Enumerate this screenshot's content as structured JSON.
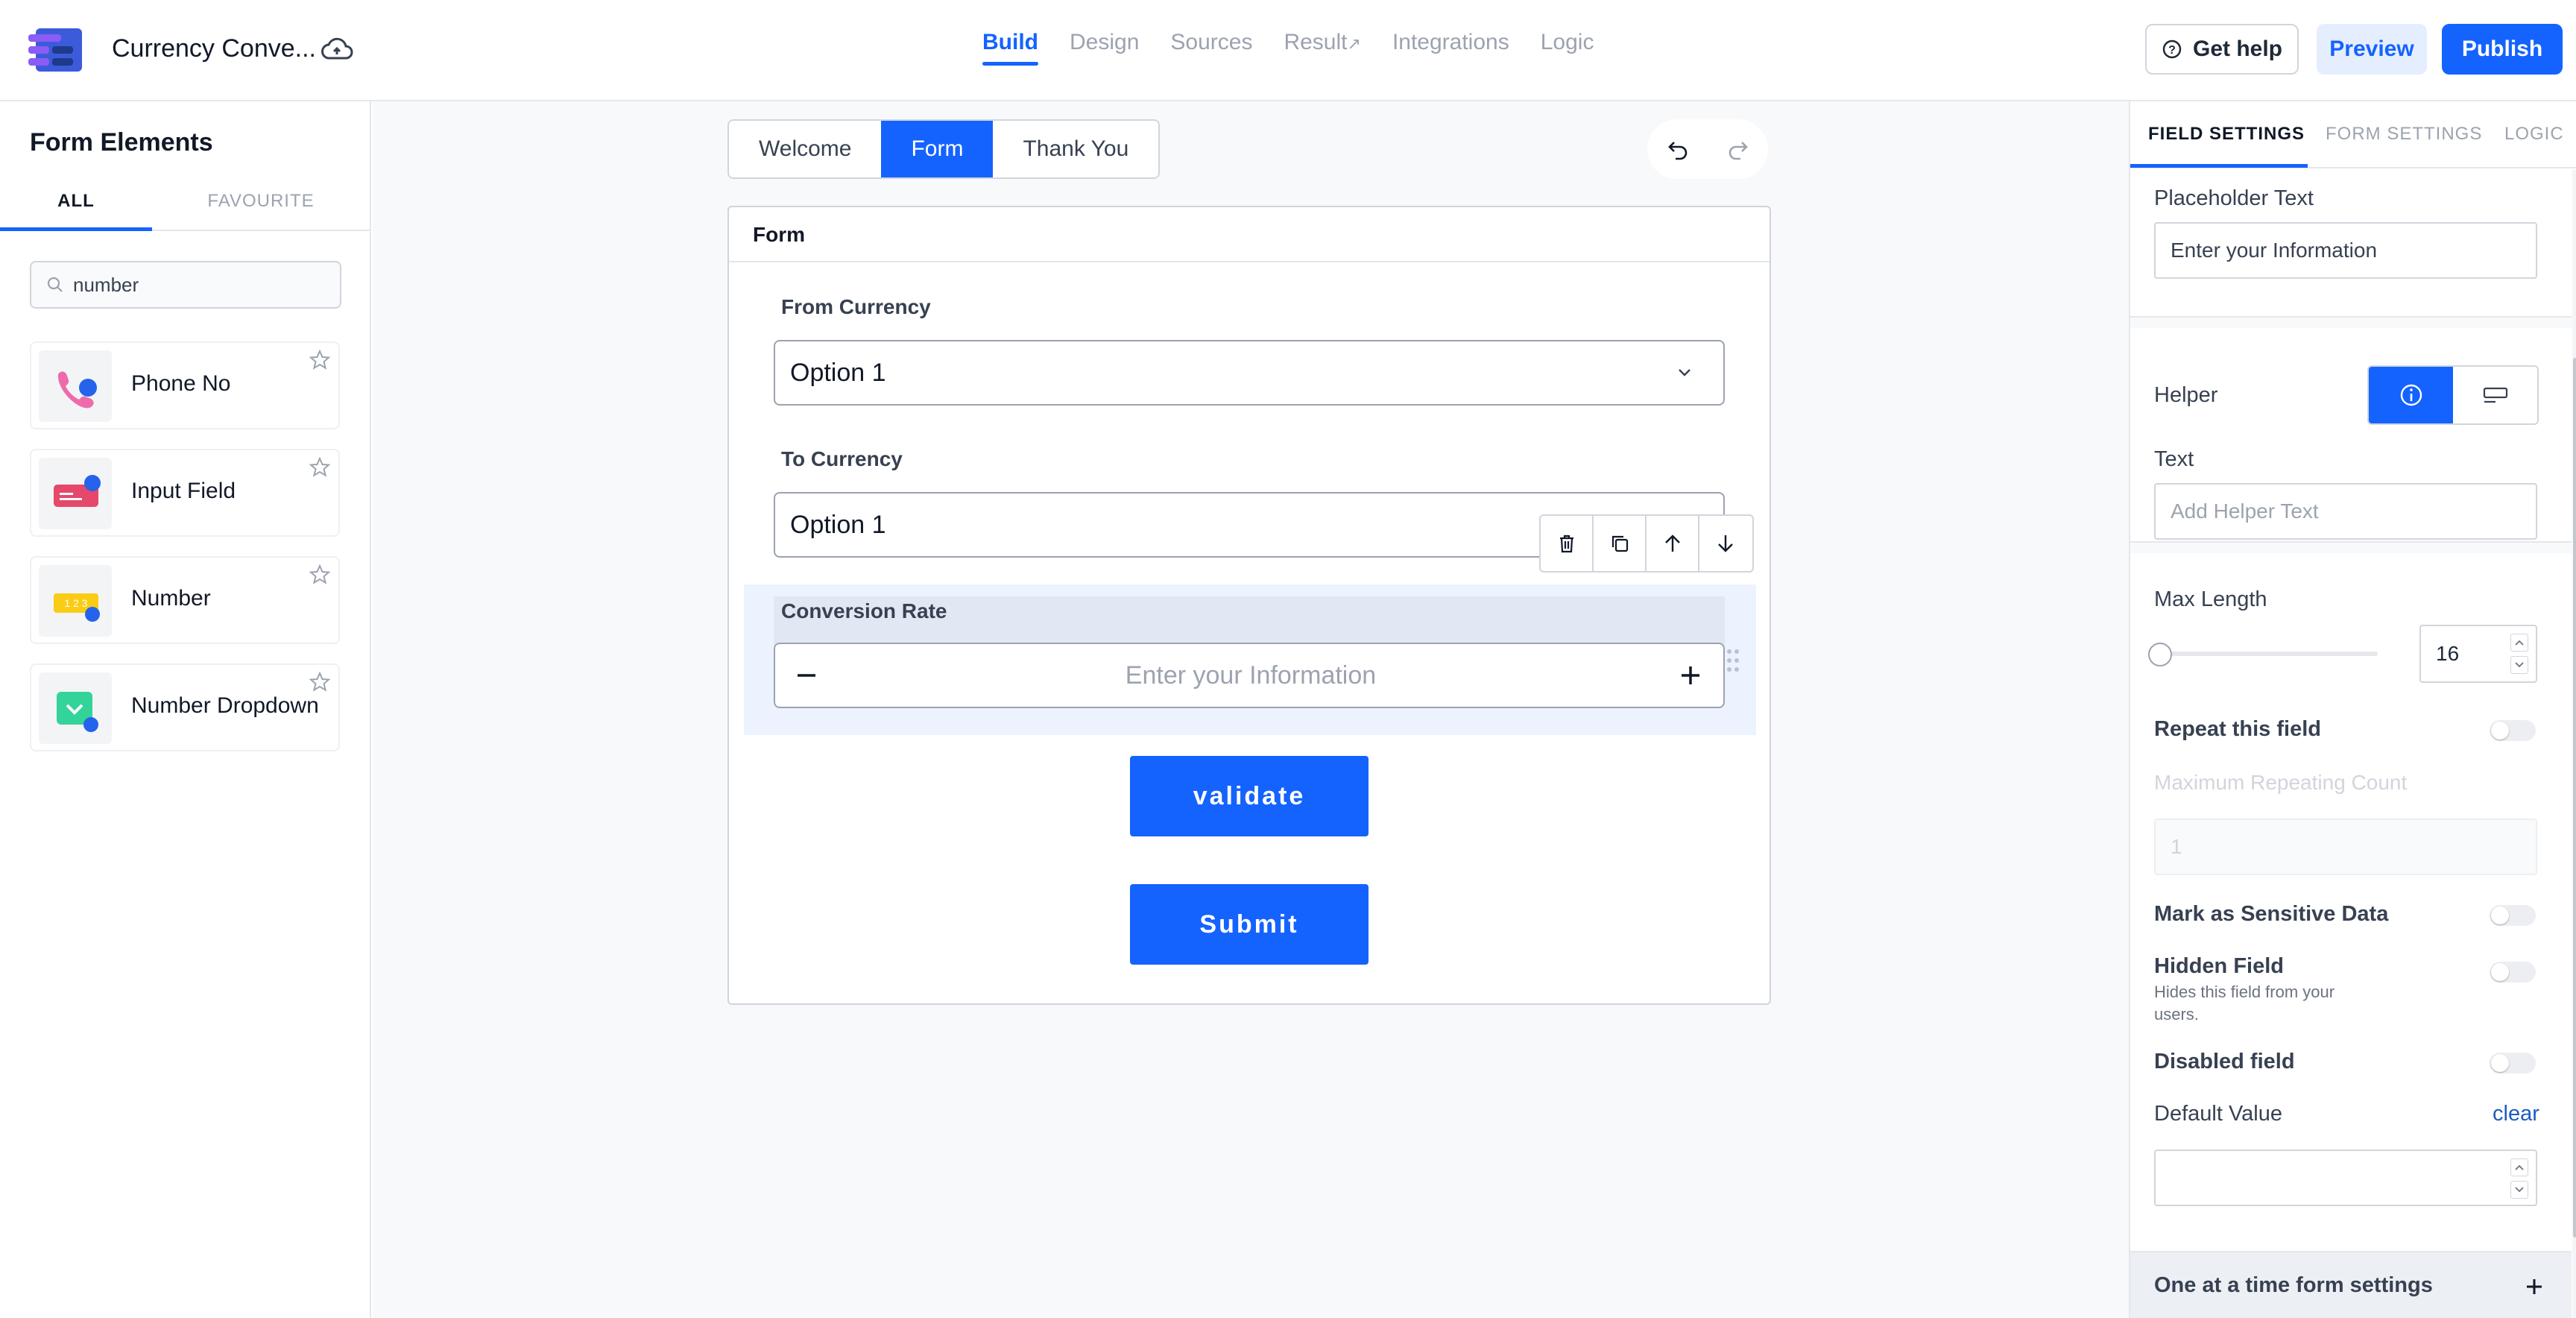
{
  "app": {
    "title": "Currency Conve...",
    "icons": {
      "logo": "stacked-logo-icon",
      "save": "cloud-save-icon"
    }
  },
  "nav": {
    "tabs": [
      {
        "label": "Build",
        "active": true
      },
      {
        "label": "Design"
      },
      {
        "label": "Sources"
      },
      {
        "label": "Result",
        "icon": "external-link-icon"
      },
      {
        "label": "Integrations"
      },
      {
        "label": "Logic"
      }
    ],
    "actions": {
      "help": "Get help",
      "preview": "Preview",
      "publish": "Publish"
    }
  },
  "left": {
    "title": "Form Elements",
    "tabs": [
      "ALL",
      "FAVOURITE"
    ],
    "search_value": "number",
    "elements": [
      {
        "label": "Phone No",
        "icon": "phone-icon"
      },
      {
        "label": "Input Field",
        "icon": "input-field-icon"
      },
      {
        "label": "Number",
        "icon": "number-icon"
      },
      {
        "label": "Number Dropdown",
        "icon": "number-dropdown-icon"
      }
    ]
  },
  "canvas": {
    "pages": [
      "Welcome",
      "Form",
      "Thank You"
    ],
    "active_page": "Form",
    "form": {
      "title": "Form",
      "fields": {
        "from_currency": {
          "label": "From Currency",
          "value": "Option 1"
        },
        "to_currency": {
          "label": "To Currency",
          "value": "Option 1"
        },
        "conversion_rate": {
          "label": "Conversion Rate",
          "placeholder": "Enter your Information"
        }
      },
      "buttons": {
        "validate": "validate",
        "submit": "Submit"
      }
    }
  },
  "right": {
    "tabs": [
      "FIELD SETTINGS",
      "FORM SETTINGS",
      "LOGIC"
    ],
    "placeholder_text": {
      "label": "Placeholder Text",
      "value": "Enter your Information"
    },
    "helper": {
      "label": "Helper",
      "text_label": "Text",
      "text_placeholder": "Add Helper Text"
    },
    "max_length": {
      "label": "Max Length",
      "value": "16",
      "slider_fraction": 0
    },
    "repeat": {
      "label": "Repeat this field",
      "max_count_label": "Maximum Repeating Count",
      "max_count_value": "1"
    },
    "sensitive": {
      "label": "Mark as Sensitive Data"
    },
    "hidden": {
      "label": "Hidden Field",
      "description": "Hides this field from your users."
    },
    "disabled": {
      "label": "Disabled field"
    },
    "default_value": {
      "label": "Default Value",
      "clear": "clear"
    },
    "accordion": {
      "label": "One at a time form settings"
    }
  },
  "colors": {
    "accent": "#1463ff",
    "accent_light": "#e5eefe",
    "selected_bg": "#ecf2fe"
  }
}
